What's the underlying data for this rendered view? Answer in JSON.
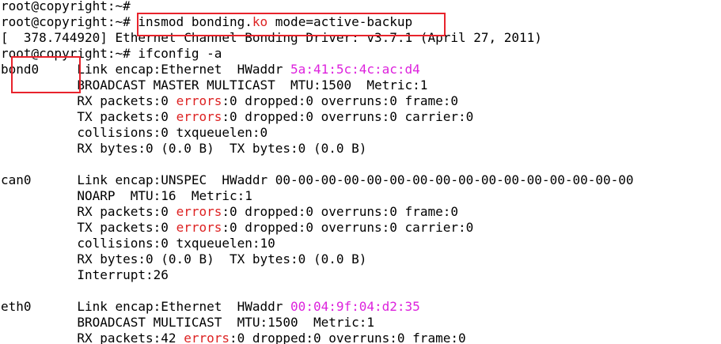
{
  "terminal": {
    "lines": [
      {
        "segments": [
          {
            "text": "root@copyright:~#"
          }
        ]
      },
      {
        "segments": [
          {
            "text": "root@copyright:~# insmod bonding."
          },
          {
            "text": "ko",
            "color": "red"
          },
          {
            "text": " mode=active-backup"
          }
        ]
      },
      {
        "segments": [
          {
            "text": "[  378.744920] Ethernet Channel Bonding Driver: v3.7.1 (April 27, 2011)"
          }
        ]
      },
      {
        "segments": [
          {
            "text": "root@copyright:~# ifconfig -a"
          }
        ]
      },
      {
        "segments": [
          {
            "text": "bond0     Link encap:Ethernet  HWaddr "
          },
          {
            "text": "5a:41:5c:4c:ac:d4",
            "color": "magenta"
          }
        ]
      },
      {
        "segments": [
          {
            "text": "          BROADCAST MASTER MULTICAST  MTU:1500  Metric:1"
          }
        ]
      },
      {
        "segments": [
          {
            "text": "          RX packets:0 "
          },
          {
            "text": "errors",
            "color": "red"
          },
          {
            "text": ":0 dropped:0 overruns:0 frame:0"
          }
        ]
      },
      {
        "segments": [
          {
            "text": "          TX packets:0 "
          },
          {
            "text": "errors",
            "color": "red"
          },
          {
            "text": ":0 dropped:0 overruns:0 carrier:0"
          }
        ]
      },
      {
        "segments": [
          {
            "text": "          collisions:0 txqueuelen:0"
          }
        ]
      },
      {
        "segments": [
          {
            "text": "          RX bytes:0 (0.0 B)  TX bytes:0 (0.0 B)"
          }
        ]
      },
      {
        "segments": [
          {
            "text": ""
          }
        ]
      },
      {
        "segments": [
          {
            "text": "can0      Link encap:UNSPEC  HWaddr 00-00-00-00-00-00-00-00-00-00-00-00-00-00-00-00"
          }
        ]
      },
      {
        "segments": [
          {
            "text": "          NOARP  MTU:16  Metric:1"
          }
        ]
      },
      {
        "segments": [
          {
            "text": "          RX packets:0 "
          },
          {
            "text": "errors",
            "color": "red"
          },
          {
            "text": ":0 dropped:0 overruns:0 frame:0"
          }
        ]
      },
      {
        "segments": [
          {
            "text": "          TX packets:0 "
          },
          {
            "text": "errors",
            "color": "red"
          },
          {
            "text": ":0 dropped:0 overruns:0 carrier:0"
          }
        ]
      },
      {
        "segments": [
          {
            "text": "          collisions:0 txqueuelen:10"
          }
        ]
      },
      {
        "segments": [
          {
            "text": "          RX bytes:0 (0.0 B)  TX bytes:0 (0.0 B)"
          }
        ]
      },
      {
        "segments": [
          {
            "text": "          Interrupt:26"
          }
        ]
      },
      {
        "segments": [
          {
            "text": ""
          }
        ]
      },
      {
        "segments": [
          {
            "text": "eth0      Link encap:Ethernet  HWaddr "
          },
          {
            "text": "00:04:9f:04:d2:35",
            "color": "magenta"
          }
        ]
      },
      {
        "segments": [
          {
            "text": "          BROADCAST MULTICAST  MTU:1500  Metric:1"
          }
        ]
      },
      {
        "segments": [
          {
            "text": "          RX packets:42 "
          },
          {
            "text": "errors",
            "color": "red"
          },
          {
            "text": ":0 dropped:0 overruns:0 frame:0"
          }
        ]
      }
    ],
    "colors": {
      "background": "#ffffff",
      "text": "#000000",
      "error_keyword": "#dd2222",
      "mac_address": "#dd22dd",
      "annotation_box": "#e8232c"
    }
  }
}
